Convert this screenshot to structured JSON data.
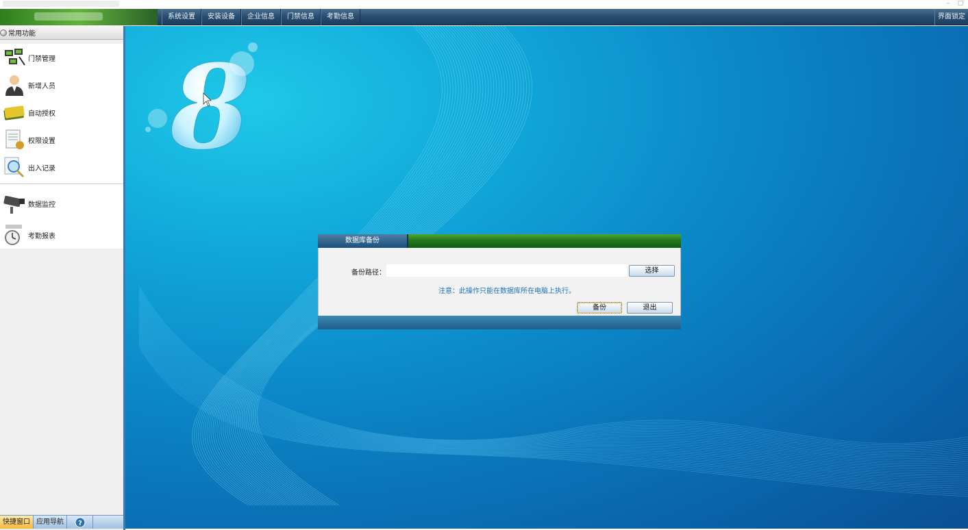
{
  "menu": {
    "items": [
      {
        "label": "系统设置"
      },
      {
        "label": "安装设备"
      },
      {
        "label": "企业信息"
      },
      {
        "label": "门禁信息"
      },
      {
        "label": "考勤信息"
      }
    ],
    "right_label": "界面锁定"
  },
  "sidebar": {
    "header": "常用功能",
    "items": [
      {
        "label": "门禁管理",
        "icon": "circuit-board-icon"
      },
      {
        "label": "新增人员",
        "icon": "person-icon"
      },
      {
        "label": "自动授权",
        "icon": "card-icon"
      },
      {
        "label": "权限设置",
        "icon": "document-icon"
      },
      {
        "label": "出入记录",
        "icon": "magnifier-icon"
      }
    ],
    "items2": [
      {
        "label": "数据监控",
        "icon": "camera-icon"
      },
      {
        "label": "考勤报表",
        "icon": "clock-icon"
      }
    ],
    "bottom_tabs": {
      "quick": "快捷窗口",
      "nav": "应用导航"
    }
  },
  "dialog": {
    "title": "数据库备份",
    "path_label": "备份路径：",
    "path_value": "",
    "choose_label": "选择",
    "note": "注意：此操作只能在数据库所在电脑上执行。",
    "backup_label": "备份",
    "exit_label": "退出"
  },
  "colors": {
    "menubar": "#2a4f71",
    "accent_green": "#23781a",
    "background_blue": "#0b86c6",
    "note_text": "#1c73b8"
  }
}
